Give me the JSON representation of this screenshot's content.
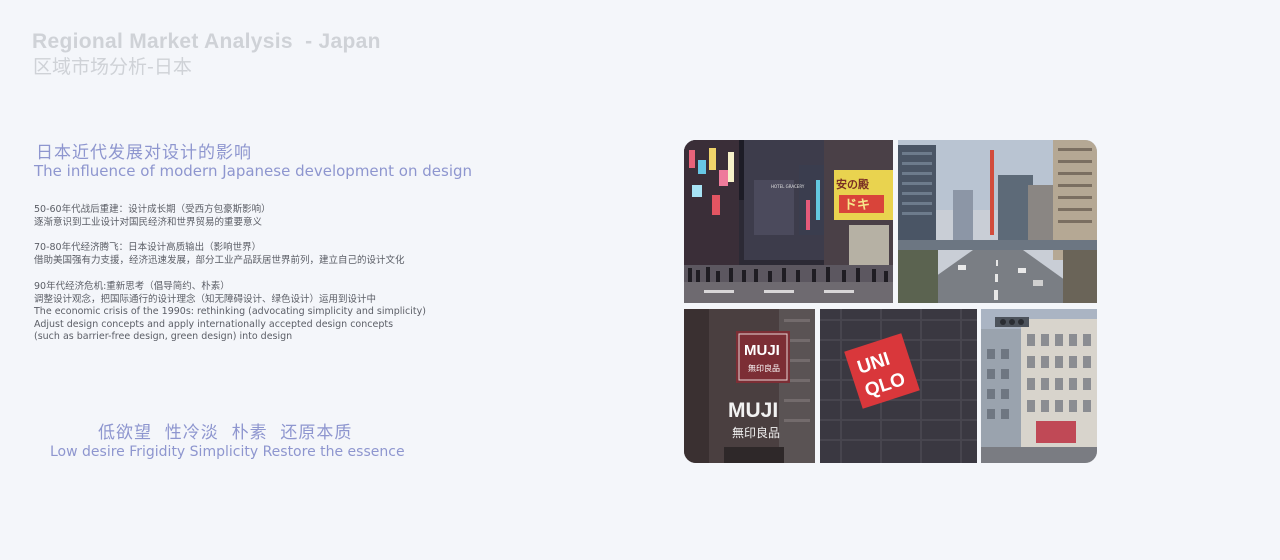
{
  "header": {
    "title_en": "Regional Market Analysis  - Japan",
    "title_cn": "区域市场分析-日本"
  },
  "section": {
    "heading_cn": "日本近代发展对设计的影响",
    "heading_en": "The influence of modern Japanese development on design"
  },
  "paragraphs": [
    [
      "50-60年代战后重建：设计成长期（受西方包豪斯影响）",
      "逐渐意识到工业设计对国民经济和世界贸易的重要意义"
    ],
    [
      "70-80年代经济腾飞：日本设计高质输出（影响世界）",
      "借助美国强有力支援，经济迅速发展，部分工业产品跃居世界前列，建立自己的设计文化"
    ],
    [
      "90年代经济危机:重新思考（倡导简约、朴素）",
      "调整设计观念，把国际通行的设计理念（知无障碍设计、绿色设计）运用到设计中",
      "The economic crisis of the 1990s: rethinking (advocating simplicity and simplicity)",
      "Adjust design concepts and apply internationally accepted design concepts",
      "(such as barrier-free design, green design) into design"
    ]
  ],
  "slogan": {
    "cn": "低欲望  性冷淡  朴素  还原本质",
    "en": "Low desire Frigidity Simplicity Restore the essence"
  },
  "photos": {
    "muji_sign": "MUJI",
    "muji_sub": "無印良品",
    "uniqlo_top": "UNI",
    "uniqlo_bottom": "QLO",
    "shinjuku_sign": "安の殿",
    "shinjuku_sign2": "ドキ",
    "shinjuku_sign3": "HOTEL GRACERY"
  }
}
